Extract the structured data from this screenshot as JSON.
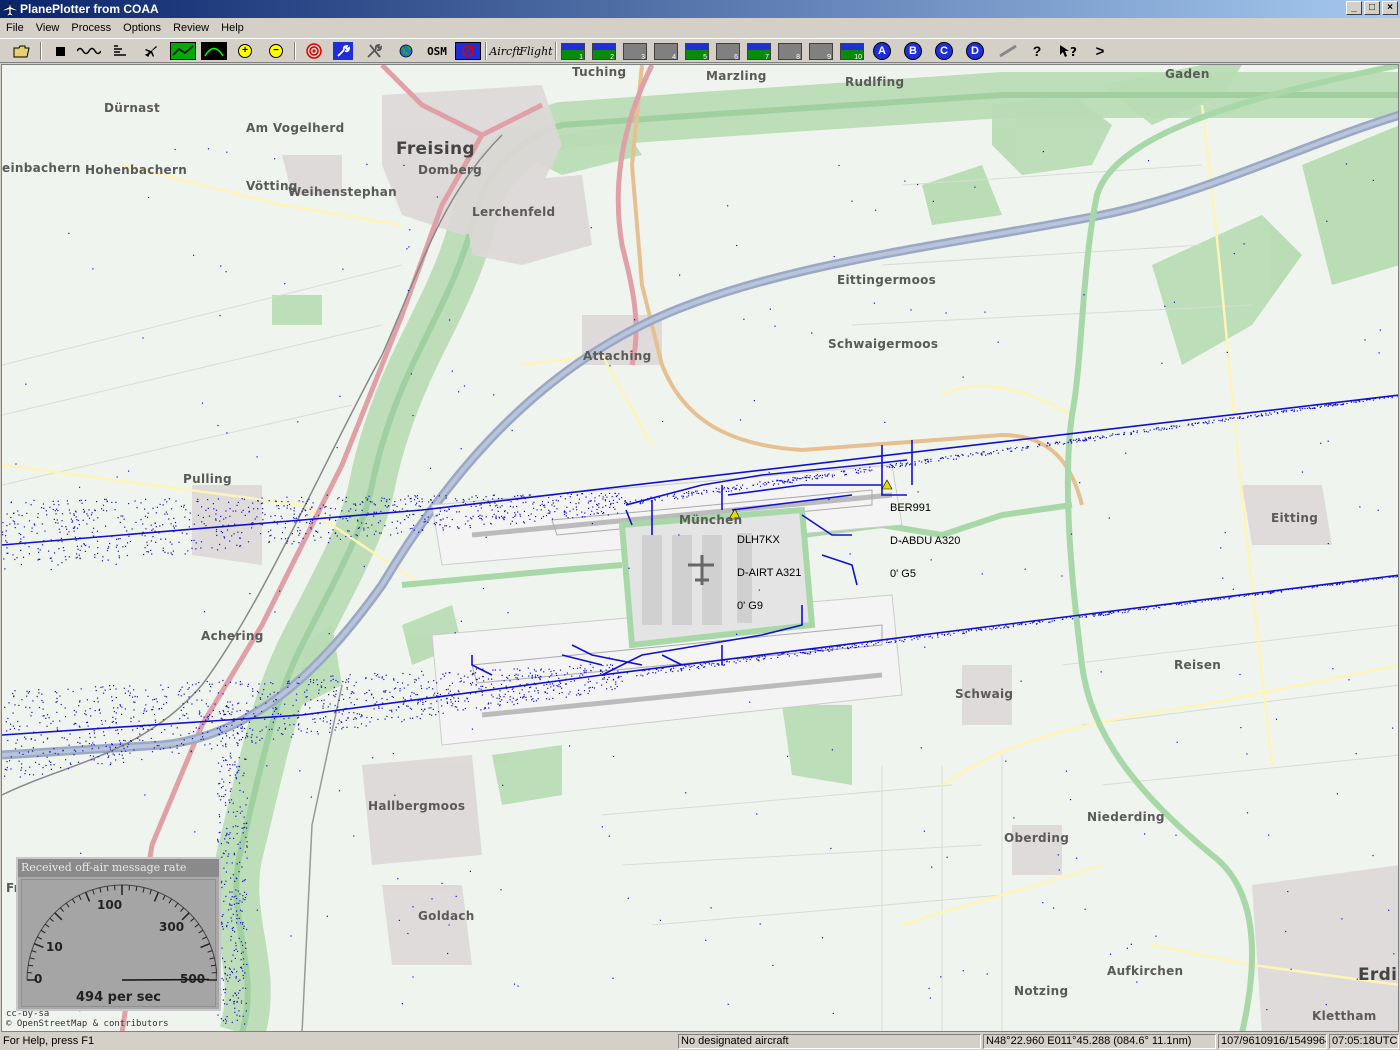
{
  "window": {
    "title": "PlanePlotter from COAA",
    "controls": [
      "_",
      "□",
      "×"
    ]
  },
  "menu": [
    "File",
    "View",
    "Process",
    "Options",
    "Review",
    "Help"
  ],
  "toolbar": {
    "osm_label": "OSM",
    "aircraft_label": "Airсft",
    "flight_label": "Flight",
    "filters": [
      {
        "n": "1",
        "on": true
      },
      {
        "n": "2",
        "on": true
      },
      {
        "n": "3",
        "on": false
      },
      {
        "n": "4",
        "on": false
      },
      {
        "n": "5",
        "on": true
      },
      {
        "n": "6",
        "on": false
      },
      {
        "n": "7",
        "on": true
      },
      {
        "n": "8",
        "on": false
      },
      {
        "n": "9",
        "on": false
      },
      {
        "n": "10",
        "on": true
      }
    ],
    "circles": [
      "A",
      "B",
      "C",
      "D"
    ],
    "more": ">"
  },
  "map": {
    "places": [
      {
        "name": "Tuching",
        "big": false
      },
      {
        "name": "Marzling",
        "big": false
      },
      {
        "name": "Rudlfing",
        "big": false
      },
      {
        "name": "Gaden",
        "big": false
      },
      {
        "name": "Dürnast",
        "big": false
      },
      {
        "name": "Am Vogelherd",
        "big": false
      },
      {
        "name": "Freising",
        "big": true
      },
      {
        "name": "Domberg",
        "big": false
      },
      {
        "name": "einbachern",
        "big": false
      },
      {
        "name": "Hohenbachern",
        "big": false
      },
      {
        "name": "Vötting",
        "big": false
      },
      {
        "name": "Weihenstephan",
        "big": false
      },
      {
        "name": "Lerchenfeld",
        "big": false
      },
      {
        "name": "Eittingermoos",
        "big": false
      },
      {
        "name": "Schwaigermoos",
        "big": false
      },
      {
        "name": "Attaching",
        "big": false
      },
      {
        "name": "Pulling",
        "big": false
      },
      {
        "name": "München",
        "big": false
      },
      {
        "name": "Eitting",
        "big": false
      },
      {
        "name": "Achering",
        "big": false
      },
      {
        "name": "Reisen",
        "big": false
      },
      {
        "name": "Schwaig",
        "big": false
      },
      {
        "name": "Hallbergmoos",
        "big": false
      },
      {
        "name": "Niederding",
        "big": false
      },
      {
        "name": "Oberding",
        "big": false
      },
      {
        "name": "Goldach",
        "big": false
      },
      {
        "name": "Aufkirchen",
        "big": false
      },
      {
        "name": "Notzing",
        "big": false
      },
      {
        "name": "Erdi",
        "big": true
      },
      {
        "name": "Klettham",
        "big": false
      },
      {
        "name": "Fr",
        "big": false
      }
    ],
    "aircraft": [
      {
        "callsign": "BER991",
        "reg": "D-ABDU A320",
        "alt": "0' G5"
      },
      {
        "callsign": "DLH7KX",
        "reg": "D-AIRT A321",
        "alt": "0' G9"
      }
    ],
    "credit": "© OpenStreetMap & contributors",
    "credit_license": "cc-by-sa",
    "colors": {
      "tracks": "#1010d0",
      "motorway": "#9aa8c4",
      "primary": "#e8a0a8",
      "green": "#a8d8a8"
    }
  },
  "gauge": {
    "title": "Received off-air message rate",
    "ticks": [
      "0",
      "10",
      "100",
      "300",
      "500"
    ],
    "value": 494,
    "value_label": "494 per sec"
  },
  "status": {
    "help": "For Help, press F1",
    "designated": "No designated aircraft",
    "position": "N48°22.960 E011°45.288 (084.6°  11.1nm)",
    "counts": "107/9610916/1549964",
    "time": "07:05:18UTC"
  }
}
